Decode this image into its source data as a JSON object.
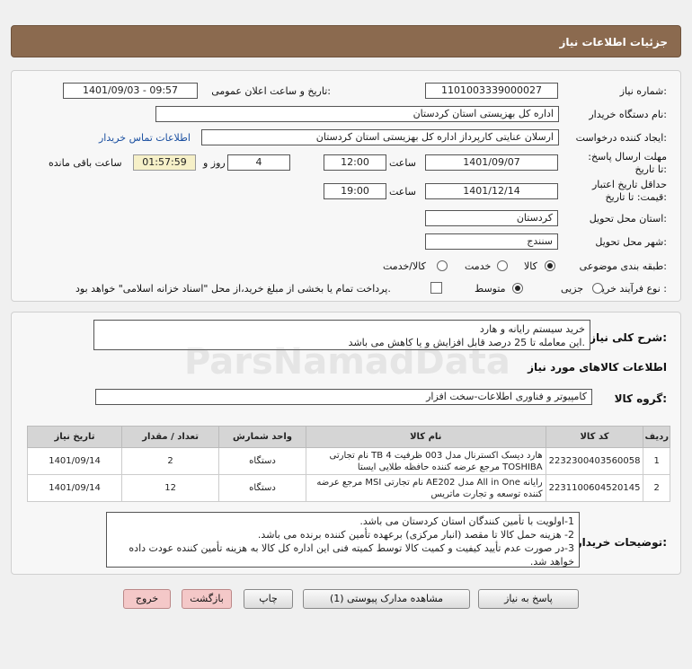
{
  "header": {
    "title": "جزئیات اطلاعات نیاز"
  },
  "form": {
    "need_number_label": "شماره نیاز:",
    "need_number": "1101003339000027",
    "announce_label": "تاریخ و ساعت اعلان عمومی:",
    "announce_value": "1401/09/03 - 09:57",
    "buyer_org_label": "نام دستگاه خریدار:",
    "buyer_org": "اداره کل بهزیستی استان کردستان",
    "creator_label": "ایجاد کننده درخواست:",
    "creator": "ارسلان  عنایتی کارپرداز اداره کل بهزیستی استان کردستان",
    "contact_link": "اطلاعات تماس خریدار",
    "deadline_label": "مهلت ارسال پاسخ: تا تاریخ:",
    "deadline_date": "1401/09/07",
    "time_label": "ساعت",
    "deadline_time": "12:00",
    "days_value": "4",
    "days_label": "روز و",
    "remaining_time": "01:57:59",
    "remaining_label": "ساعت باقی مانده",
    "validity_label": "حداقل تاریخ اعتبار قیمت: تا تاریخ:",
    "validity_date": "1401/12/14",
    "validity_time": "19:00",
    "province_label": "استان محل تحویل:",
    "province": "کردستان",
    "city_label": "شهر محل تحویل:",
    "city": "سنندج",
    "category_label": "طبقه بندی موضوعی:",
    "category_options": [
      "کالا",
      "خدمت",
      "کالا/خدمت"
    ],
    "process_label": "نوع فرآیند خرید :",
    "process_options": [
      "جزیی",
      "متوسط"
    ],
    "payment_note": "پرداخت تمام یا بخشی از مبلغ خرید،از محل \"اسناد خزانه اسلامی\" خواهد بود."
  },
  "details": {
    "general_label": "شرح کلی نیاز:",
    "general_lines": [
      "خرید سیستم رایانه و هارد",
      "این معامله تا 25 درصد قابل افزایش و یا کاهش می باشد."
    ],
    "goods_info_label": "اطلاعات کالاهای مورد نیاز",
    "group_label": "گروه کالا:",
    "group_value": "کامپیوتر و فناوری اطلاعات-سخت افزار",
    "table_headers": [
      "ردیف",
      "کد کالا",
      "نام کالا",
      "واحد شمارش",
      "تعداد / مقدار",
      "تاریخ نیاز"
    ],
    "rows": [
      [
        "1",
        "2232300403560058",
        "هارد دیسک اکسترنال مدل 003 ظرفیت 4 TB نام تجارتی TOSHIBA مرجع عرضه کننده حافظه طلایی ایستا",
        "دستگاه",
        "2",
        "1401/09/14"
      ],
      [
        "2",
        "2231100604520145",
        "رایانه All in One مدل AE202 نام تجارتی MSI مرجع عرضه کننده توسعه و تجارت ماتریس",
        "دستگاه",
        "12",
        "1401/09/14"
      ]
    ],
    "buyer_notes_label": "توضیحات خریدار:",
    "buyer_notes": [
      "1-اولویت با تأمین کنندگان استان کردستان می باشد.",
      "2- هزینه حمل کالا تا مقصد (انبار مرکزی) برعهده تأمین کننده برنده می باشد.",
      "3-در صورت عدم تأیید کیفیت و کمیت کالا توسط کمیته فنی این اداره کل کالا به هزینه تأمین کننده عودت داده خواهد شد."
    ]
  },
  "buttons": {
    "reply": "پاسخ به نیاز",
    "view_docs": "مشاهده مدارک پیوستی (1)",
    "print": "چاپ",
    "back": "بازگشت",
    "exit": "خروج"
  },
  "watermark": {
    "brand": "ParsNamadData"
  },
  "colors": {
    "header_bg": "#8b6a4f",
    "table_header_bg": "#d5d5d5",
    "link": "#1a4fa0",
    "remaining_bg": "#f6f0c8"
  }
}
